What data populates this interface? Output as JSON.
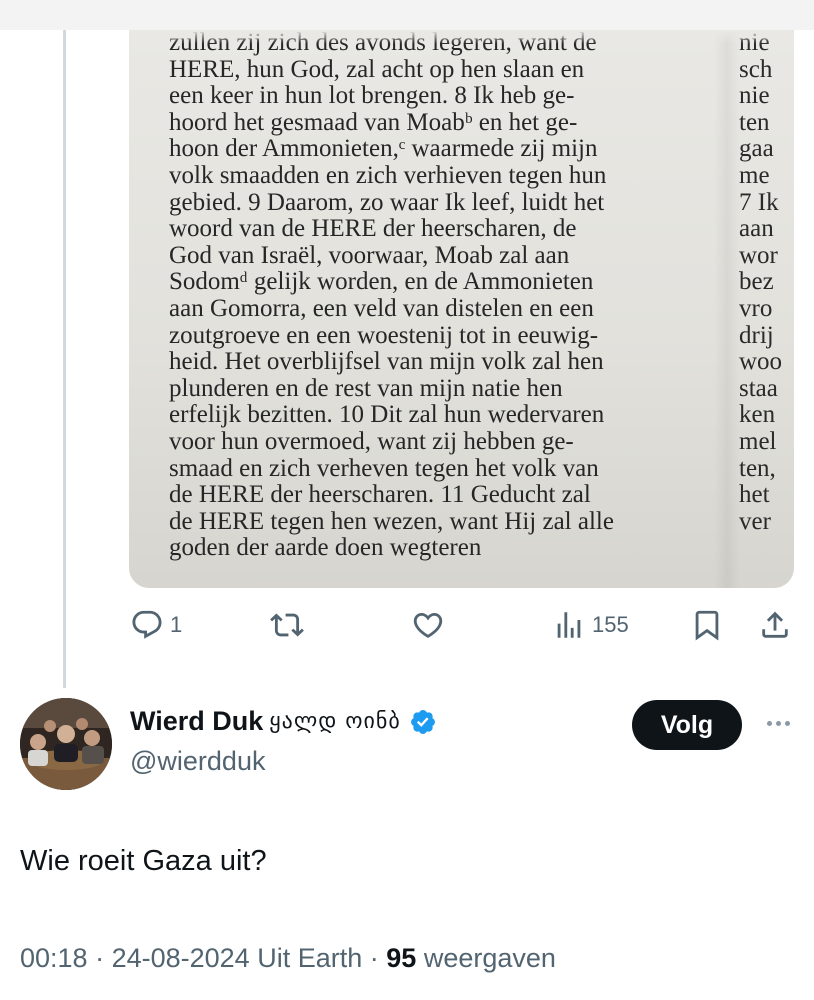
{
  "quoted_image": {
    "left_column": [
      "zullen zij zich des avonds legeren, want de",
      "HERE, hun God, zal acht op hen slaan en",
      "een keer in hun lot brengen. 8 Ik heb ge-",
      "hoord het gesmaad van Moabᵇ en het ge-",
      "hoon der Ammonieten,ᶜ waarmede zij mijn",
      "volk smaadden en zich verhieven tegen hun",
      "gebied. 9 Daarom, zo waar Ik leef, luidt het",
      "woord van de HERE der heerscharen, de",
      "God van Israël, voorwaar, Moab zal aan",
      "Sodomᵈ gelijk worden, en de Ammonieten",
      "aan Gomorra, een veld van distelen en een",
      "zoutgroeve en een woestenij tot in eeuwig-",
      "heid. Het overblijfsel van mijn volk zal hen",
      "plunderen en de rest van mijn natie hen",
      "erfelijk bezitten. 10 Dit zal hun wedervaren",
      "voor hun overmoed, want zij hebben ge-",
      "smaad en zich verheven tegen het volk van",
      "de HERE der heerscharen. 11 Geducht zal",
      "de HERE tegen hen wezen, want Hij zal alle",
      "goden der aarde doen wegteren"
    ],
    "right_column": [
      "nie",
      "sch",
      "nie",
      "ten",
      "gaa",
      "me",
      "7 Ik",
      "aan",
      "wor",
      "bez",
      "vro",
      "drij",
      "woo",
      "staa",
      "ken",
      "mel",
      "ten,",
      "het",
      "ver"
    ]
  },
  "actions": {
    "reply_count": "1",
    "views_count": "155"
  },
  "author": {
    "name": "Wierd Duk",
    "name_script": "ყალდ ოინბ",
    "handle": "@wierdduk",
    "follow_label": "Volg"
  },
  "tweet": {
    "text": "Wie roeit Gaza uit?",
    "time": "00:18",
    "date": "24-08-2024",
    "location": "Uit Earth",
    "views": "95",
    "views_label": "weergaven"
  },
  "colors": {
    "muted": "#536471",
    "verified": "#1d9bf0",
    "text": "#0f1419"
  }
}
